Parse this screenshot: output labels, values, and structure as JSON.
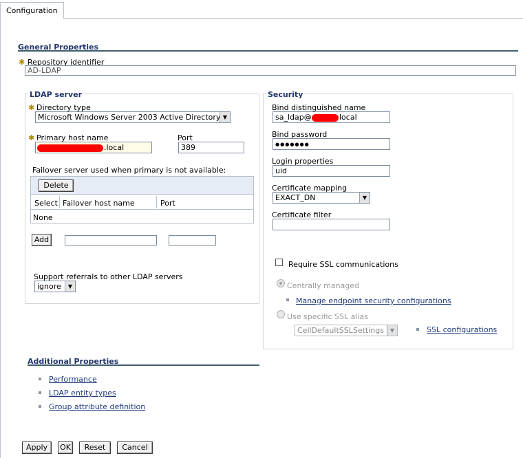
{
  "tab": {
    "label": "Configuration"
  },
  "general": {
    "title": "General Properties",
    "repository_label": "Repository identifier",
    "repository_value": "AD-LDAP"
  },
  "ldap": {
    "legend": "LDAP server",
    "directory_type_label": "Directory type",
    "directory_type_value": "Microsoft Windows Server 2003 Active Directory",
    "primary_host_label": "Primary host name",
    "primary_host_suffix": ".local",
    "port_label": "Port",
    "port_value": "389",
    "failover_caption": "Failover server used when primary is not available:",
    "delete_label": "Delete",
    "columns": [
      "Select",
      "Failover host name",
      "Port"
    ],
    "none_text": "None",
    "add_label": "Add",
    "referrals_label": "Support referrals to other LDAP servers",
    "referrals_value": "ignore"
  },
  "security": {
    "legend": "Security",
    "bind_dn_label": "Bind distinguished name",
    "bind_dn_prefix": "sa_ldap@",
    "bind_dn_suffix": "local",
    "bind_password_label": "Bind password",
    "bind_password_value": "●●●●●●●",
    "login_props_label": "Login properties",
    "login_props_value": "uid",
    "cert_mapping_label": "Certificate mapping",
    "cert_mapping_value": "EXACT_DN",
    "cert_filter_label": "Certificate filter",
    "cert_filter_value": "",
    "require_ssl_label": "Require SSL communications",
    "centrally_managed_label": "Centrally managed",
    "manage_endpoint_link": "Manage endpoint security configurations",
    "use_ssl_alias_label": "Use specific SSL alias",
    "ssl_alias_value": "CellDefaultSSLSettings",
    "ssl_config_link": "SSL configurations"
  },
  "additional": {
    "title": "Additional Properties",
    "links": [
      "Performance",
      "LDAP entity types",
      "Group attribute definition"
    ]
  },
  "actions": {
    "apply": "Apply",
    "ok": "OK",
    "reset": "Reset",
    "cancel": "Cancel"
  },
  "colors": {
    "section_title": "#21356b",
    "rule": "#3f5e6e",
    "redaction": "#ff0000",
    "link": "#1f3a7a"
  }
}
